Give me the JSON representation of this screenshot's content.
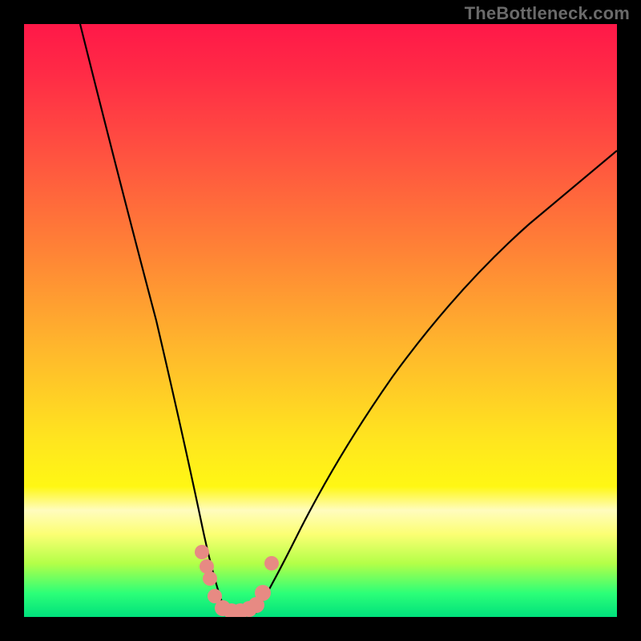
{
  "watermark": {
    "text": "TheBottleneck.com"
  },
  "chart_data": {
    "type": "line",
    "title": "",
    "xlabel": "",
    "ylabel": "",
    "xlim": [
      0,
      100
    ],
    "ylim": [
      0,
      100
    ],
    "grid": false,
    "legend": false,
    "description": "Bottleneck curve: two black curved lines descending steeply from upper-left and upper-right toward a small flat trough near x≈32–40 at y≈0–4, over a vertical rainbow gradient (red top → green bottom) inside a black frame. Salmon-colored dot markers cluster around the trough.",
    "series": [
      {
        "name": "left-branch",
        "type": "curve",
        "color": "#000000",
        "points": [
          {
            "x": 9.5,
            "y": 100
          },
          {
            "x": 14.5,
            "y": 83
          },
          {
            "x": 18.5,
            "y": 66
          },
          {
            "x": 22.0,
            "y": 50
          },
          {
            "x": 25.0,
            "y": 35
          },
          {
            "x": 27.5,
            "y": 22
          },
          {
            "x": 29.5,
            "y": 12
          },
          {
            "x": 31.0,
            "y": 6
          },
          {
            "x": 32.5,
            "y": 2
          },
          {
            "x": 34.0,
            "y": 0.5
          }
        ]
      },
      {
        "name": "right-branch",
        "type": "curve",
        "color": "#000000",
        "points": [
          {
            "x": 39.0,
            "y": 0.5
          },
          {
            "x": 41.0,
            "y": 3
          },
          {
            "x": 44.0,
            "y": 8
          },
          {
            "x": 48.0,
            "y": 16
          },
          {
            "x": 53.0,
            "y": 26
          },
          {
            "x": 59.0,
            "y": 37
          },
          {
            "x": 66.0,
            "y": 48
          },
          {
            "x": 74.0,
            "y": 58
          },
          {
            "x": 83.0,
            "y": 67
          },
          {
            "x": 92.0,
            "y": 74
          },
          {
            "x": 100.0,
            "y": 79
          }
        ]
      },
      {
        "name": "trough-markers",
        "type": "scatter",
        "color": "#e78a83",
        "points": [
          {
            "x": 30.0,
            "y": 11.0
          },
          {
            "x": 30.8,
            "y": 8.5
          },
          {
            "x": 31.4,
            "y": 6.5
          },
          {
            "x": 32.2,
            "y": 3.5
          },
          {
            "x": 33.5,
            "y": 1.5
          },
          {
            "x": 35.0,
            "y": 1.0
          },
          {
            "x": 36.5,
            "y": 1.0
          },
          {
            "x": 38.0,
            "y": 1.3
          },
          {
            "x": 39.2,
            "y": 2.0
          },
          {
            "x": 40.2,
            "y": 4.0
          },
          {
            "x": 41.8,
            "y": 9.0
          }
        ]
      }
    ]
  }
}
